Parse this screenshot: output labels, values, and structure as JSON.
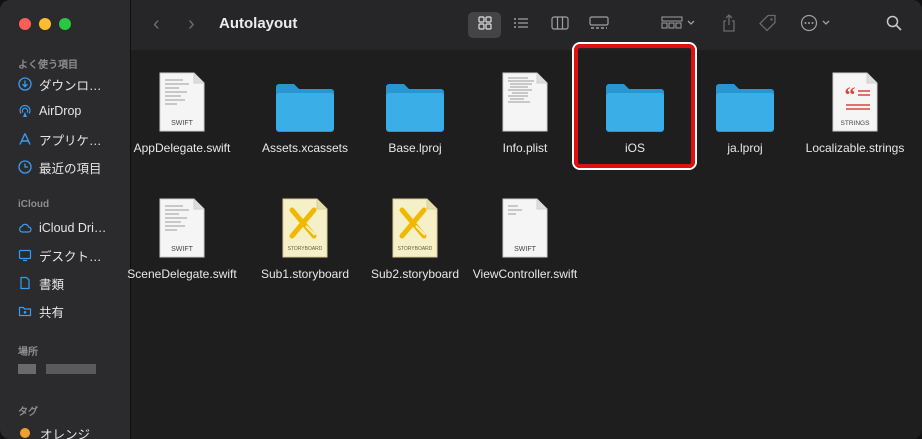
{
  "window": {
    "title": "Autolayout"
  },
  "sidebar": {
    "favorites_header": "よく使う項目",
    "favorites": [
      {
        "label": "ダウンロ…",
        "icon": "download-icon"
      },
      {
        "label": "AirDrop",
        "icon": "airdrop-icon"
      },
      {
        "label": "アプリケ…",
        "icon": "applications-icon"
      },
      {
        "label": "最近の項目",
        "icon": "recents-icon"
      }
    ],
    "icloud_header": "iCloud",
    "icloud": [
      {
        "label": "iCloud Dri…",
        "icon": "cloud-icon"
      },
      {
        "label": "デスクト…",
        "icon": "desktop-icon"
      },
      {
        "label": "書類",
        "icon": "document-icon"
      },
      {
        "label": "共有",
        "icon": "shared-folder-icon"
      }
    ],
    "locations_header": "場所",
    "tags_header": "タグ",
    "tags": [
      {
        "label": "オレンジ",
        "color": "#f0a030"
      }
    ]
  },
  "files": [
    {
      "name": "AppDelegate.swift",
      "type": "swift",
      "badge": "SWIFT"
    },
    {
      "name": "Assets.xcassets",
      "type": "folder"
    },
    {
      "name": "Base.lproj",
      "type": "folder"
    },
    {
      "name": "Info.plist",
      "type": "plist"
    },
    {
      "name": "iOS",
      "type": "folder",
      "selected": true
    },
    {
      "name": "ja.lproj",
      "type": "folder"
    },
    {
      "name": "Localizable.strings",
      "type": "strings",
      "badge": "STRINGS"
    },
    {
      "name": "SceneDelegate.swift",
      "type": "swift",
      "badge": "SWIFT"
    },
    {
      "name": "Sub1.storyboard",
      "type": "storyboard",
      "badge": "STORYBOARD"
    },
    {
      "name": "Sub2.storyboard",
      "type": "storyboard",
      "badge": "STORYBOARD"
    },
    {
      "name": "ViewController.swift",
      "type": "swift",
      "badge": "SWIFT"
    }
  ],
  "colors": {
    "folder": "#3aaee6",
    "highlight": "#e01010",
    "strings_red": "#d8473c"
  }
}
